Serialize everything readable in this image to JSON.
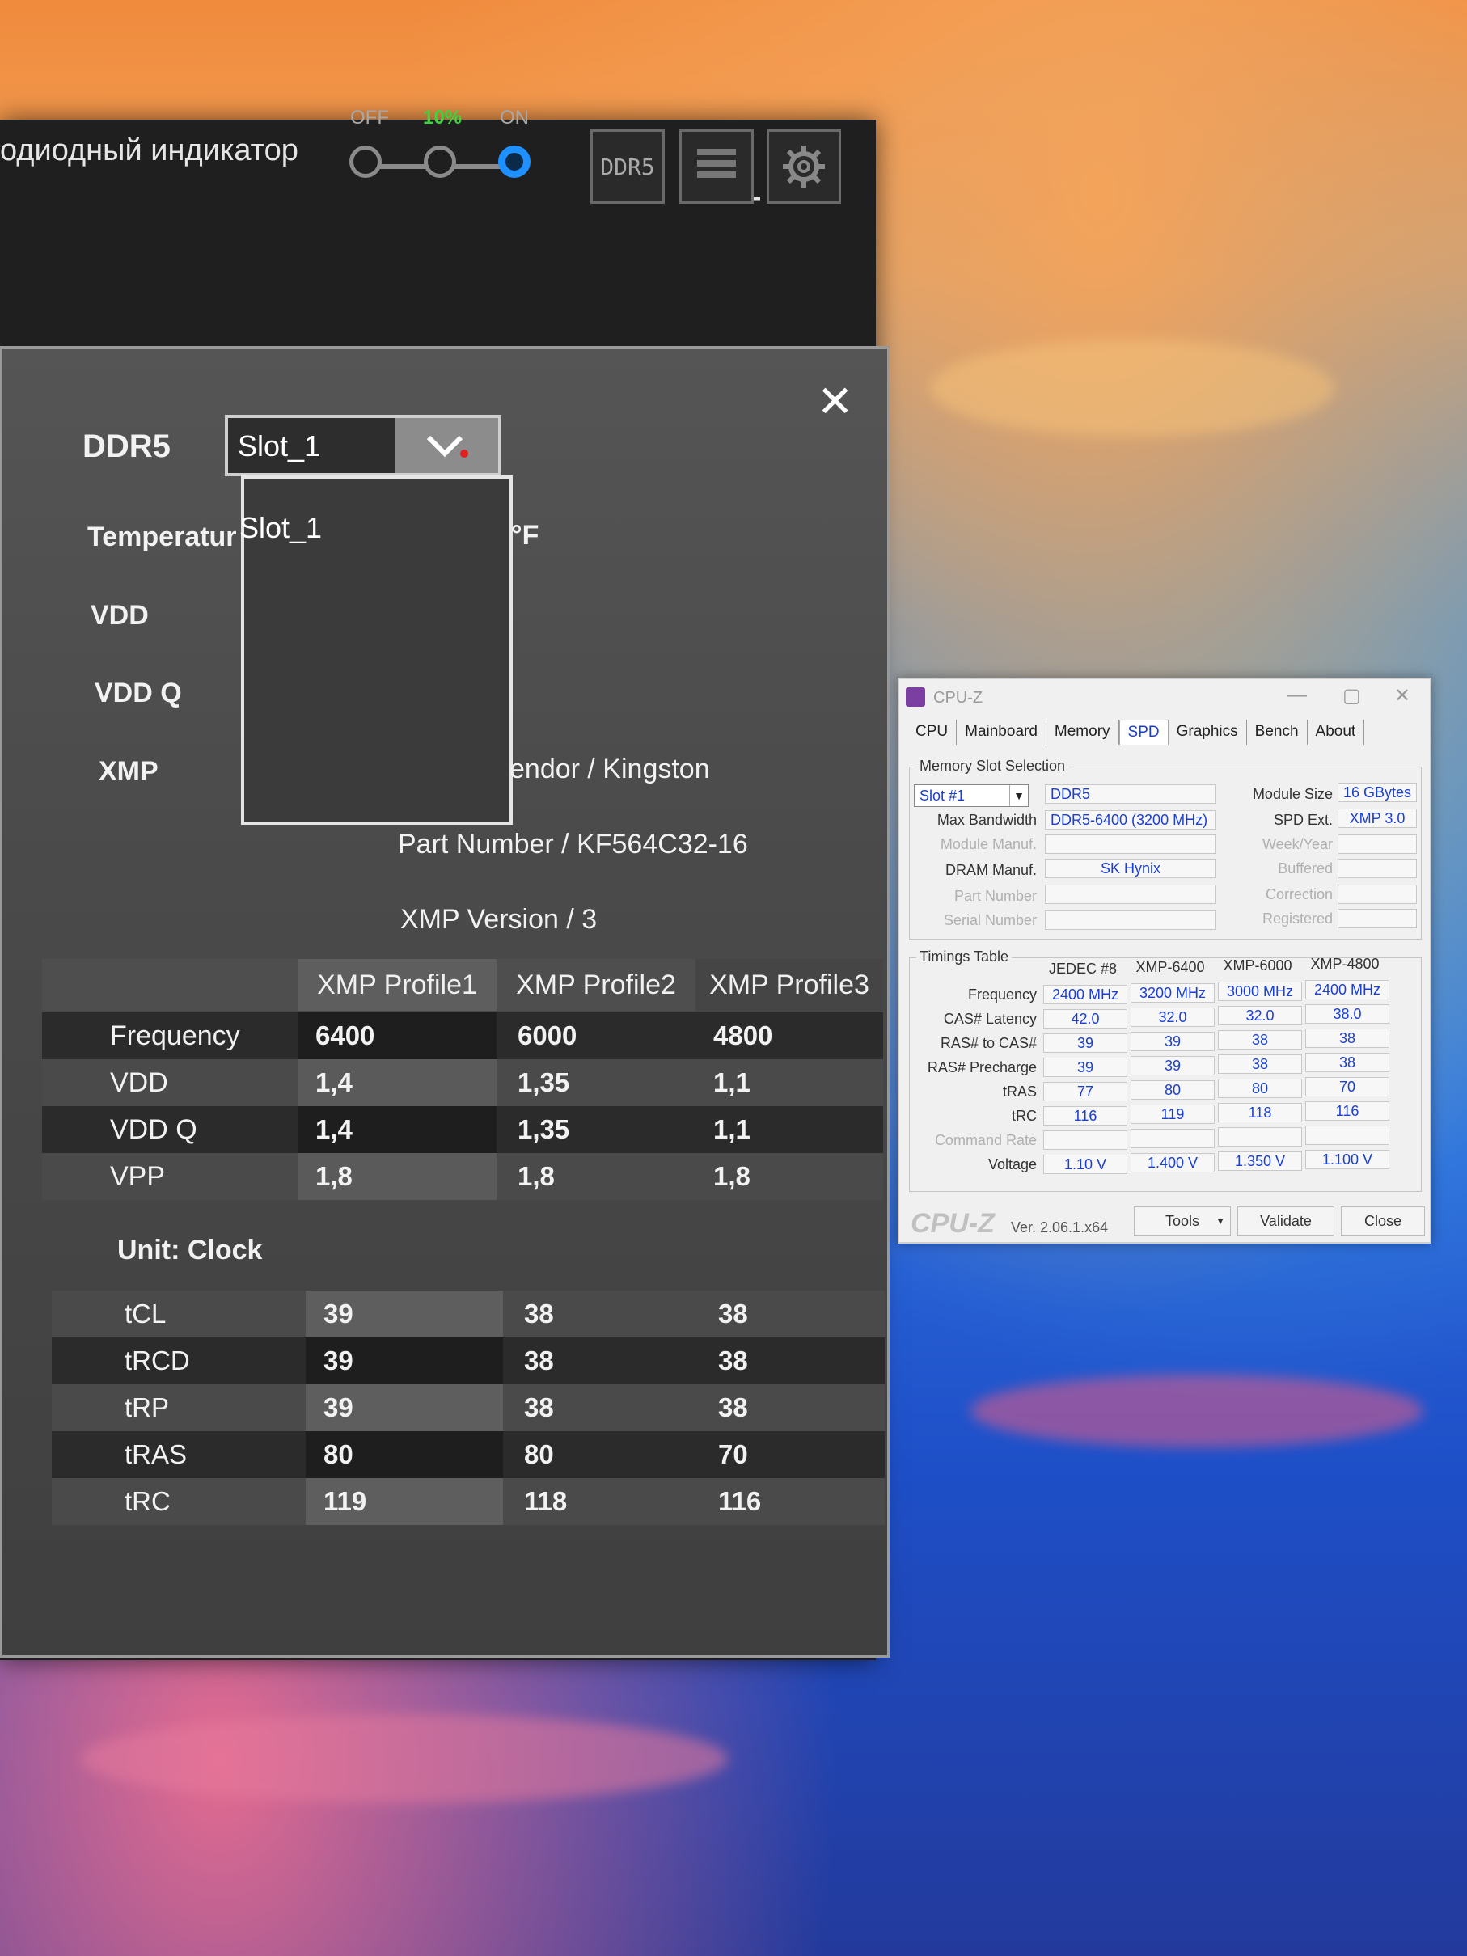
{
  "app": {
    "header_title": "одиодный индикатор",
    "led": {
      "off_label": "OFF",
      "mid_label": "10%",
      "on_label": "ON"
    },
    "tools": {
      "ddr5_label": "DDR5"
    },
    "panel": {
      "memory_type": "DDR5",
      "slot_selected": "Slot_1",
      "slot_options": [
        "Slot_1"
      ],
      "temperature_label": "Temperatur",
      "temperature_unit": "°F",
      "vdd_label": "VDD",
      "vddq_label": "VDD Q",
      "xmp_label": "XMP",
      "vendor_text": "endor / Kingston",
      "part_number_text": "Part Number / KF564C32-16",
      "xmp_version_text": "XMP Version / 3",
      "profile_headers": [
        "XMP Profile1",
        "XMP Profile2",
        "XMP Profile3"
      ],
      "voltage_rows": [
        {
          "label": "Frequency",
          "values": [
            "6400",
            "6000",
            "4800"
          ]
        },
        {
          "label": "VDD",
          "values": [
            "1,4",
            "1,35",
            "1,1"
          ]
        },
        {
          "label": "VDD Q",
          "values": [
            "1,4",
            "1,35",
            "1,1"
          ]
        },
        {
          "label": "VPP",
          "values": [
            "1,8",
            "1,8",
            "1,8"
          ]
        }
      ],
      "unit_label": "Unit: Clock",
      "timing_rows": [
        {
          "label": "tCL",
          "values": [
            "39",
            "38",
            "38"
          ]
        },
        {
          "label": "tRCD",
          "values": [
            "39",
            "38",
            "38"
          ]
        },
        {
          "label": "tRP",
          "values": [
            "39",
            "38",
            "38"
          ]
        },
        {
          "label": "tRAS",
          "values": [
            "80",
            "80",
            "70"
          ]
        },
        {
          "label": "tRC",
          "values": [
            "119",
            "118",
            "116"
          ]
        }
      ]
    }
  },
  "cpuz": {
    "title": "CPU-Z",
    "tabs": [
      "CPU",
      "Mainboard",
      "Memory",
      "SPD",
      "Graphics",
      "Bench",
      "About"
    ],
    "active_tab": "SPD",
    "slot_group_title": "Memory Slot Selection",
    "slot_value": "Slot #1",
    "memory_type": "DDR5",
    "module_size_label": "Module Size",
    "module_size": "16 GBytes",
    "max_bandwidth_label": "Max Bandwidth",
    "max_bandwidth": "DDR5-6400 (3200 MHz)",
    "spd_ext_label": "SPD Ext.",
    "spd_ext": "XMP 3.0",
    "module_manuf_label": "Module Manuf.",
    "week_year_label": "Week/Year",
    "dram_manuf_label": "DRAM Manuf.",
    "dram_manuf": "SK Hynix",
    "buffered_label": "Buffered",
    "part_number_label": "Part Number",
    "correction_label": "Correction",
    "serial_number_label": "Serial Number",
    "registered_label": "Registered",
    "timings_title": "Timings Table",
    "timing_columns": [
      "JEDEC #8",
      "XMP-6400",
      "XMP-6000",
      "XMP-4800"
    ],
    "timing_rows": [
      {
        "label": "Frequency",
        "values": [
          "2400 MHz",
          "3200 MHz",
          "3000 MHz",
          "2400 MHz"
        ]
      },
      {
        "label": "CAS# Latency",
        "values": [
          "42.0",
          "32.0",
          "32.0",
          "38.0"
        ]
      },
      {
        "label": "RAS# to CAS#",
        "values": [
          "39",
          "39",
          "38",
          "38"
        ]
      },
      {
        "label": "RAS# Precharge",
        "values": [
          "39",
          "39",
          "38",
          "38"
        ]
      },
      {
        "label": "tRAS",
        "values": [
          "77",
          "80",
          "80",
          "70"
        ]
      },
      {
        "label": "tRC",
        "values": [
          "116",
          "119",
          "118",
          "116"
        ]
      },
      {
        "label": "Command Rate",
        "values": [
          "",
          "",
          "",
          ""
        ]
      },
      {
        "label": "Voltage",
        "values": [
          "1.10 V",
          "1.400 V",
          "1.350 V",
          "1.100 V"
        ]
      }
    ],
    "footer_logo": "CPU-Z",
    "version": "Ver. 2.06.1.x64",
    "tools_label": "Tools",
    "validate_label": "Validate",
    "close_label": "Close"
  }
}
